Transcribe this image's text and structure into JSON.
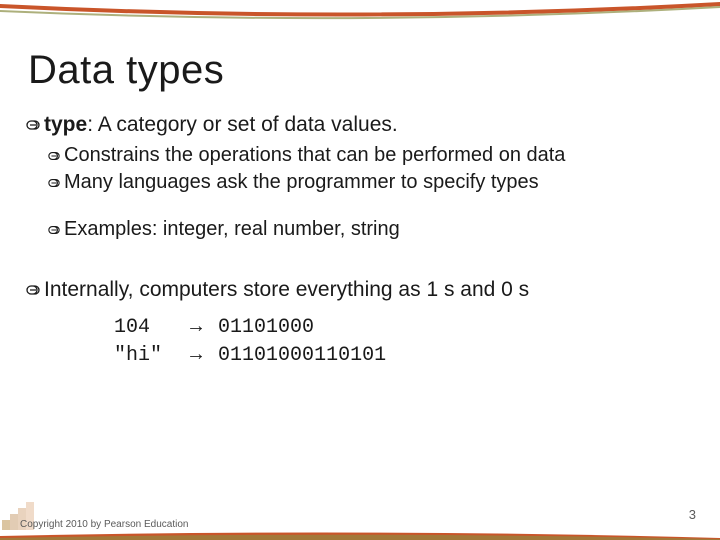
{
  "title": "Data types",
  "bullets": {
    "b1_strong": "type",
    "b1_rest": ": A category or set of data values.",
    "b1a": "Constrains the operations that can be performed on data",
    "b1b": "Many languages ask the programmer to specify types",
    "b1c": "Examples: integer, real number, string",
    "b2": "Internally, computers store everything as 1 s and 0 s"
  },
  "mono": {
    "r1_left": "104",
    "r1_right": "01101000",
    "r2_left": "\"hi\"",
    "r2_right": "01101000110101",
    "arrow": "→"
  },
  "footer": {
    "copyright": "Copyright 2010 by Pearson Education",
    "page": "3"
  },
  "colors": {
    "accent1": "#c9552a",
    "accent2": "#8a8f45"
  }
}
